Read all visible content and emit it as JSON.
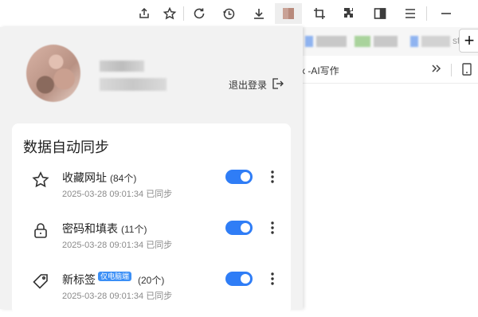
{
  "toolbar": {
    "icons": [
      "share-icon",
      "star-icon",
      "reload-icon",
      "history-icon",
      "download-icon",
      "profile-avatar",
      "crop-icon",
      "extensions-icon",
      "sidebar-icon",
      "menu-icon",
      "minimize-icon"
    ]
  },
  "browser": {
    "tab_ghost_text": "st",
    "bookmark_text": "x -AI写作"
  },
  "account": {
    "logout_label": "退出登录"
  },
  "sync": {
    "title": "数据自动同步",
    "items": [
      {
        "icon": "star-icon",
        "title": "收藏网址",
        "count": "(84个)",
        "badge": "",
        "time": "2025-03-28 09:01:34 已同步",
        "enabled": true
      },
      {
        "icon": "lock-icon",
        "title": "密码和填表",
        "count": "(11个)",
        "badge": "",
        "time": "2025-03-28 09:01:34 已同步",
        "enabled": true
      },
      {
        "icon": "tag-icon",
        "title": "新标签",
        "count": "(20个)",
        "badge": "仅电脑端",
        "time": "2025-03-28 09:01:34 已同步",
        "enabled": true
      }
    ]
  },
  "colors": {
    "accent": "#2f7df6",
    "panel_bg": "#f2f2f2",
    "card_bg": "#ffffff"
  }
}
